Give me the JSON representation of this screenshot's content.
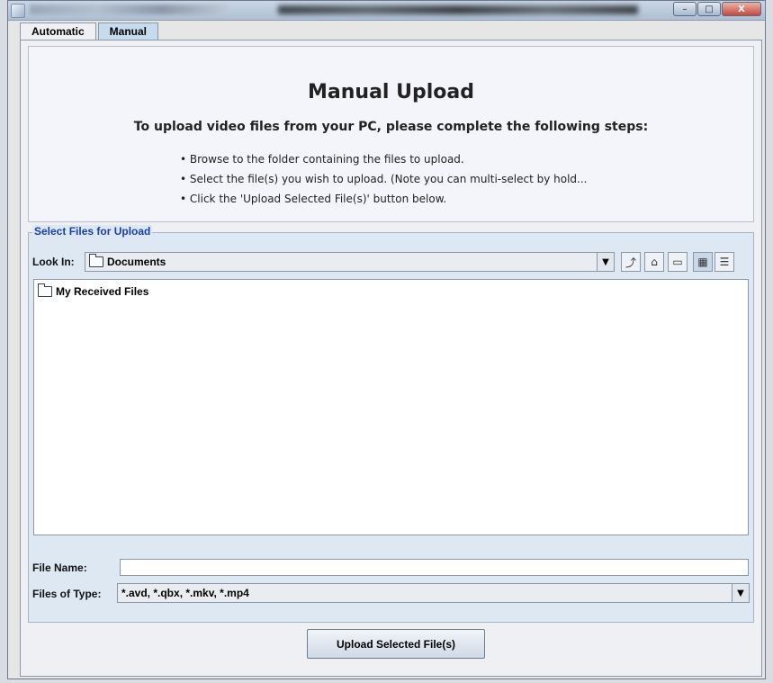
{
  "window": {
    "minimize_label": "–",
    "maximize_label": "□",
    "close_label": "X"
  },
  "tabs": [
    {
      "label": "Automatic",
      "active": false
    },
    {
      "label": "Manual",
      "active": true
    }
  ],
  "intro": {
    "title": "Manual Upload",
    "subtitle": "To upload video files from your PC, please complete the following steps:",
    "steps": [
      "Browse to the folder containing the files to upload.",
      "Select the file(s) you wish to upload. (Note you can multi-select by hold...",
      "Click the 'Upload Selected File(s)' button below."
    ]
  },
  "chooser": {
    "legend": "Select Files for Upload",
    "look_in_label": "Look In:",
    "look_in_value": "Documents",
    "toolbar": [
      {
        "name": "up-one-level-icon",
        "glyph": "⤴"
      },
      {
        "name": "home-icon",
        "glyph": "⌂"
      },
      {
        "name": "new-folder-icon",
        "glyph": "▭"
      },
      {
        "name": "list-view-icon",
        "glyph": "▦",
        "active": true
      },
      {
        "name": "details-view-icon",
        "glyph": "☰"
      }
    ],
    "files": [
      "My Received Files"
    ],
    "file_name_label": "File Name:",
    "file_name_value": "",
    "files_of_type_label": "Files of Type:",
    "files_of_type_value": "*.avd, *.qbx, *.mkv, *.mp4"
  },
  "upload_button_label": "Upload Selected File(s)",
  "colors": {
    "tab_active": "#c7dbee",
    "legend": "#1a3fb0",
    "fieldset_bg": "#dde8f3"
  }
}
